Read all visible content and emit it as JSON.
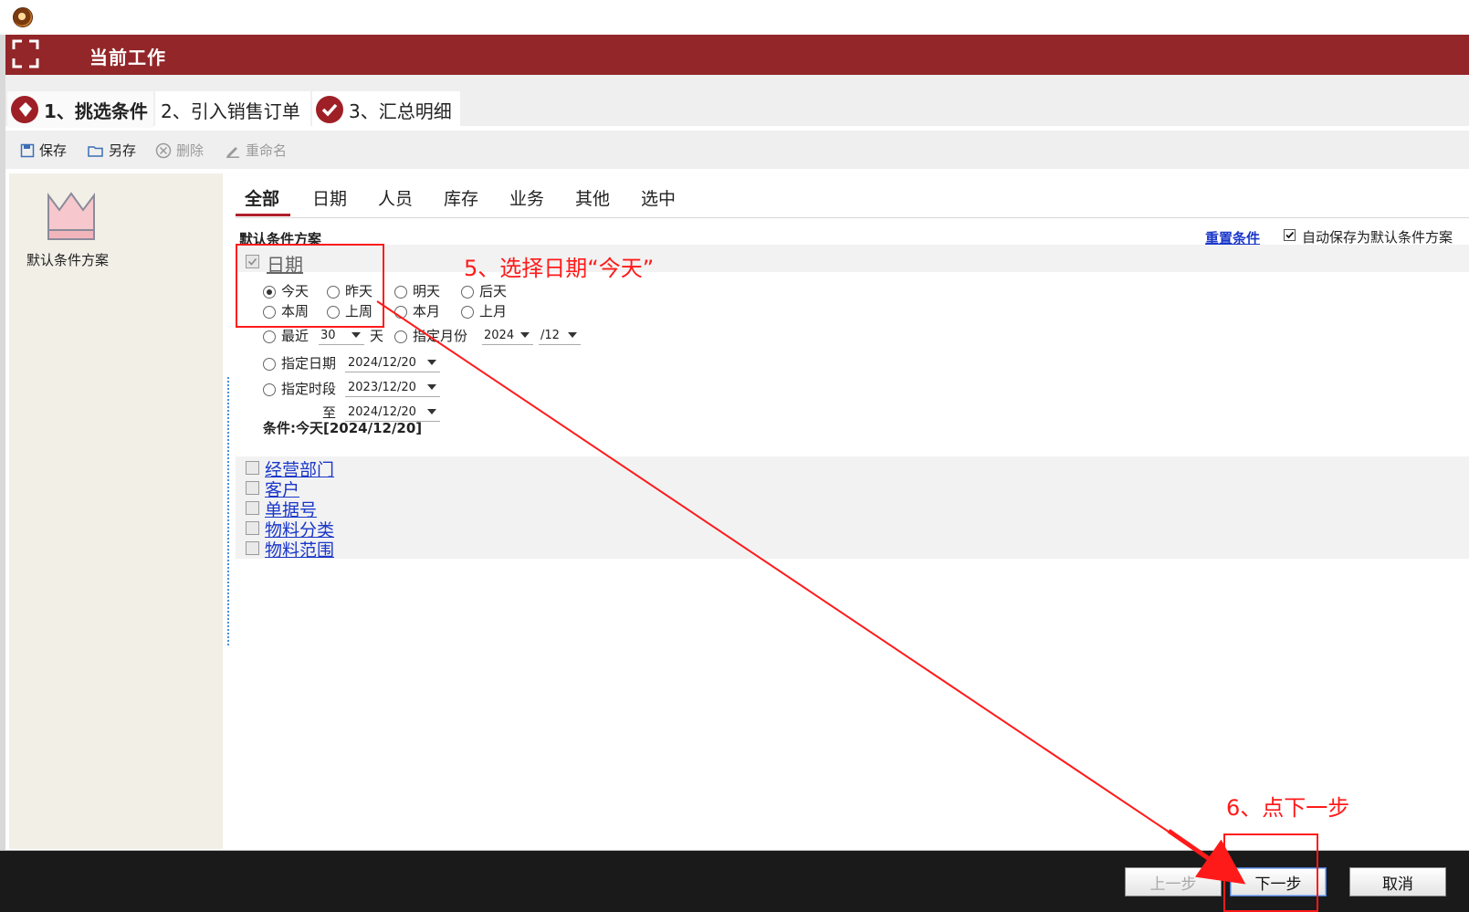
{
  "header": {
    "title": "当前工作"
  },
  "steps": [
    {
      "label": "1、挑选条件"
    },
    {
      "label": "2、引入销售订单"
    },
    {
      "label": "3、汇总明细"
    }
  ],
  "toolbar": {
    "save": "保存",
    "save_as": "另存",
    "delete": "删除",
    "rename": "重命名"
  },
  "left_panel": {
    "scheme_label": "默认条件方案"
  },
  "tabs": [
    "全部",
    "日期",
    "人员",
    "库存",
    "业务",
    "其他",
    "选中"
  ],
  "scheme": {
    "title": "默认条件方案",
    "reset_link": "重置条件",
    "autosave_label": "自动保存为默认条件方案"
  },
  "date_section": {
    "heading": "日期",
    "options_row1": [
      "今天",
      "昨天",
      "明天",
      "后天"
    ],
    "options_row2": [
      "本周",
      "上周",
      "本月",
      "上月"
    ],
    "recent_label": "最近",
    "recent_value": "30",
    "recent_unit": "天",
    "month_label": "指定月份",
    "month_year": "2024",
    "month_month": "/12",
    "date_label": "指定日期",
    "date_value": "2024/12/20",
    "period_label": "指定时段",
    "period_from": "2023/12/20",
    "period_to_label": "至",
    "period_to": "2024/12/20",
    "condition": "条件:今天[2024/12/20]"
  },
  "filters": [
    "经营部门",
    "客户",
    "单据号",
    "物料分类",
    "物料范围"
  ],
  "footer": {
    "prev": "上一步",
    "next": "下一步",
    "cancel": "取消"
  },
  "annotations": {
    "step5": "5、选择日期“今天”",
    "step6": "6、点下一步"
  },
  "colors": {
    "header_bg": "#922629",
    "annotation": "#ff1a1a",
    "link": "#1a37c9",
    "footer_bg": "#1a1a1a"
  }
}
